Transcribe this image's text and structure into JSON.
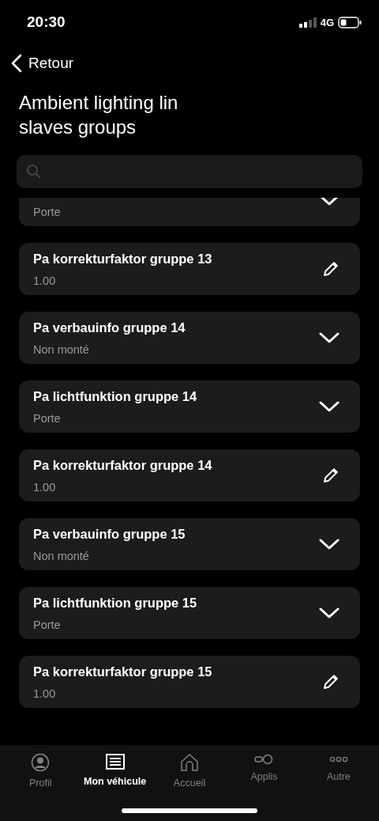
{
  "status_bar": {
    "time": "20:30",
    "network": "4G"
  },
  "back": {
    "label": "Retour"
  },
  "title": "Ambient lighting lin slaves groups",
  "items": [
    {
      "kind": "select",
      "value": "Porte",
      "clipped": true
    },
    {
      "kind": "edit",
      "name": "Pa korrekturfaktor gruppe 13",
      "value": "1.00"
    },
    {
      "kind": "select",
      "name": "Pa verbauinfo gruppe 14",
      "value": "Non monté"
    },
    {
      "kind": "select",
      "name": "Pa lichtfunktion gruppe 14",
      "value": "Porte"
    },
    {
      "kind": "edit",
      "name": "Pa korrekturfaktor gruppe 14",
      "value": "1.00"
    },
    {
      "kind": "select",
      "name": "Pa verbauinfo gruppe 15",
      "value": "Non monté"
    },
    {
      "kind": "select",
      "name": "Pa lichtfunktion gruppe 15",
      "value": "Porte"
    },
    {
      "kind": "edit",
      "name": "Pa korrekturfaktor gruppe 15",
      "value": "1.00"
    }
  ],
  "tabs": [
    {
      "kind": "profile",
      "label": "Profil",
      "selected": false
    },
    {
      "kind": "vehicle",
      "label": "Mon véhicule",
      "selected": true
    },
    {
      "kind": "home",
      "label": "Accueil",
      "selected": false
    },
    {
      "kind": "apps",
      "label": "Applis",
      "selected": false
    },
    {
      "kind": "more",
      "label": "Autre",
      "selected": false
    }
  ]
}
